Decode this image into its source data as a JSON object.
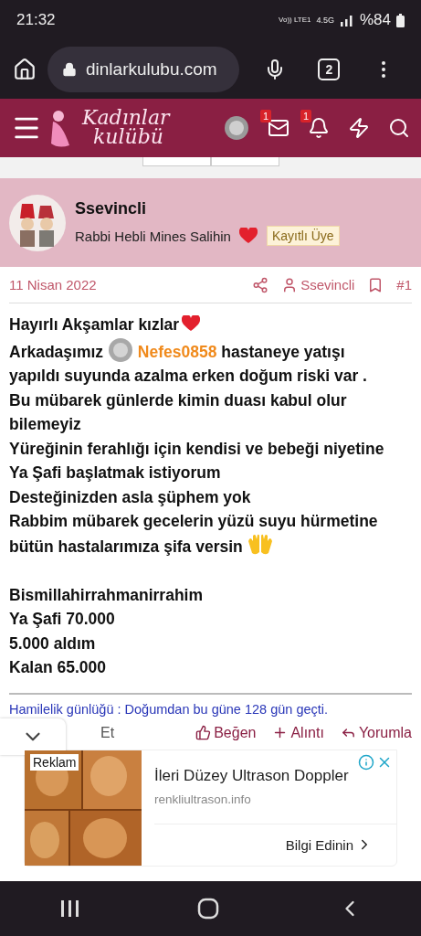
{
  "status_bar": {
    "time": "21:32",
    "network": "Vo)) LTE1",
    "network_type": "4.5G",
    "battery": "%84"
  },
  "browser": {
    "url": "dinlarkulubu.com",
    "tab_count": "2"
  },
  "site_header": {
    "logo_line1": "Kadınlar",
    "logo_line2": "kulübü",
    "messages_badge": "1",
    "alerts_badge": "1"
  },
  "post": {
    "author": "Ssevincli",
    "signature": "Rabbi Hebli Mines Salihin",
    "user_title": "Kayıtlı Üye",
    "date": "11 Nisan 2022",
    "meta_author": "Ssevincli",
    "post_number": "#1",
    "lines": [
      {
        "kind": "heart",
        "text": "Hayırlı Akşamlar kızlar"
      },
      {
        "kind": "mention",
        "before": "Arkadaşımız",
        "mention": "Nefes0858",
        "after": "hastaneye yatışı"
      },
      {
        "kind": "plain",
        "text": "yapıldı suyunda azalma erken doğum riski var ."
      },
      {
        "kind": "plain",
        "text": "Bu mübarek günlerde kimin duası kabul olur"
      },
      {
        "kind": "plain",
        "text": "bilemeyiz"
      },
      {
        "kind": "plain",
        "text": "Yüreğinin ferahlığı için kendisi ve bebeği niyetine"
      },
      {
        "kind": "plain",
        "text": "Ya Şafi başlatmak istiyorum"
      },
      {
        "kind": "plain",
        "text": "Desteğinizden asla şüphem yok"
      },
      {
        "kind": "plain",
        "text": "Rabbim mübarek gecelerin yüzü suyu hürmetine"
      },
      {
        "kind": "hands",
        "text": "bütün hastalarımıza şifa versin"
      },
      {
        "kind": "blank"
      },
      {
        "kind": "plain",
        "text": "Bismillahirrahmanirrahim"
      },
      {
        "kind": "plain",
        "text": "Ya Şafi 70.000"
      },
      {
        "kind": "plain",
        "text": "5.000 aldım"
      },
      {
        "kind": "plain",
        "text": "Kalan 65.000"
      }
    ],
    "footer_signature": "Hamilelik günlüğü : Doğumdan bu güne 128 gün geçti.",
    "report_fragment": "Et",
    "actions": [
      "Beğen",
      "Alıntı",
      "Yorumla"
    ]
  },
  "ad": {
    "label": "Reklam",
    "title": "İleri Düzey Ultrason Doppler",
    "domain": "renkliultrason.info",
    "cta": "Bilgi Edinin"
  }
}
